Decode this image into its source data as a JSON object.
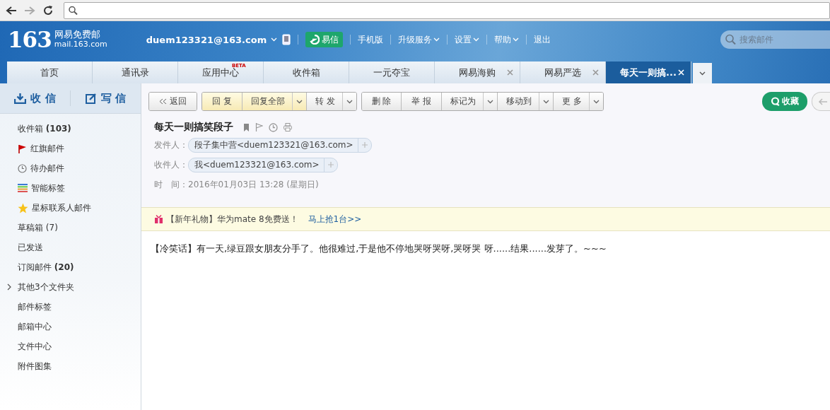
{
  "header": {
    "logo": {
      "number": "163",
      "name": "网易免费邮",
      "domain": "mail.163.com"
    },
    "account": "duem123321@163.com",
    "yixin": "易信",
    "links": [
      {
        "label": "手机版",
        "has_menu": false
      },
      {
        "label": "升级服务",
        "has_menu": true
      },
      {
        "label": "设置",
        "has_menu": true
      },
      {
        "label": "帮助",
        "has_menu": true
      },
      {
        "label": "退出",
        "has_menu": false
      }
    ],
    "search": {
      "placeholder": "搜索邮件"
    }
  },
  "tabs": [
    {
      "label": "首页",
      "closable": false,
      "selected": false
    },
    {
      "label": "通讯录",
      "closable": false,
      "selected": false
    },
    {
      "label": "应用中心",
      "badge": "BETA",
      "closable": false,
      "selected": false
    },
    {
      "label": "收件箱",
      "closable": false,
      "selected": false
    },
    {
      "label": "一元夺宝",
      "closable": false,
      "selected": false
    },
    {
      "label": "网易海购",
      "closable": true,
      "selected": false
    },
    {
      "label": "网易严选",
      "closable": true,
      "selected": false
    },
    {
      "label": "每天一则搞...",
      "closable": true,
      "selected": true
    }
  ],
  "sidebar": {
    "actions": [
      {
        "kind": "receive",
        "label": "收 信"
      },
      {
        "kind": "compose",
        "label": "写 信"
      }
    ],
    "items": [
      {
        "label": "收件箱",
        "count": "(103)",
        "kind": "plain"
      },
      {
        "label": "红旗邮件",
        "kind": "flag"
      },
      {
        "label": "待办邮件",
        "kind": "clock"
      },
      {
        "label": "智能标签",
        "kind": "stripes"
      },
      {
        "label": "星标联系人邮件",
        "kind": "star"
      },
      {
        "label": "草稿箱 (7)",
        "kind": "plain"
      },
      {
        "label": "已发送",
        "kind": "plain"
      },
      {
        "label": "订阅邮件",
        "count": "(20)",
        "kind": "plain"
      },
      {
        "label": "其他3个文件夹",
        "kind": "expand"
      },
      {
        "label": "邮件标签",
        "kind": "plain"
      },
      {
        "label": "邮箱中心",
        "kind": "plain"
      },
      {
        "label": "文件中心",
        "kind": "plain"
      },
      {
        "label": "附件图集",
        "kind": "plain"
      }
    ]
  },
  "toolbar": {
    "groups": [
      [
        {
          "label": "返回",
          "kind": "back",
          "has_menu": false
        }
      ],
      [
        {
          "label": "回 复",
          "kind": "reply",
          "has_menu": false
        },
        {
          "label": "回复全部",
          "kind": "reply",
          "has_menu": true
        },
        {
          "label": "转 发",
          "kind": "normal",
          "has_menu": true
        }
      ],
      [
        {
          "label": "删 除",
          "kind": "normal",
          "has_menu": false
        },
        {
          "label": "举 报",
          "kind": "normal",
          "has_menu": false
        },
        {
          "label": "标记为",
          "kind": "normal",
          "has_menu": true
        },
        {
          "label": "移动到",
          "kind": "normal",
          "has_menu": true
        },
        {
          "label": "更 多",
          "kind": "normal",
          "has_menu": true
        }
      ]
    ],
    "collect": "收藏"
  },
  "message": {
    "subject": "每天一则搞笑段子",
    "fields": [
      {
        "label": "发件人：",
        "kind": "chip",
        "value": "段子集中营<duem123321@163.com>"
      },
      {
        "label": "收件人：",
        "kind": "chip",
        "value": "我<duem123321@163.com>"
      },
      {
        "label": "时　间：",
        "kind": "text",
        "value": "2016年01月03日 13:28 (星期日)"
      }
    ],
    "promo": {
      "text": "【新年礼物】华为mate 8免费送！",
      "link": "马上抢1台>>"
    },
    "body": "【冷笑话】有一天,绿豆跟女朋友分手了。他很难过,于是他不停地哭呀哭呀,哭呀哭 呀......结果......发芽了。~~~"
  }
}
